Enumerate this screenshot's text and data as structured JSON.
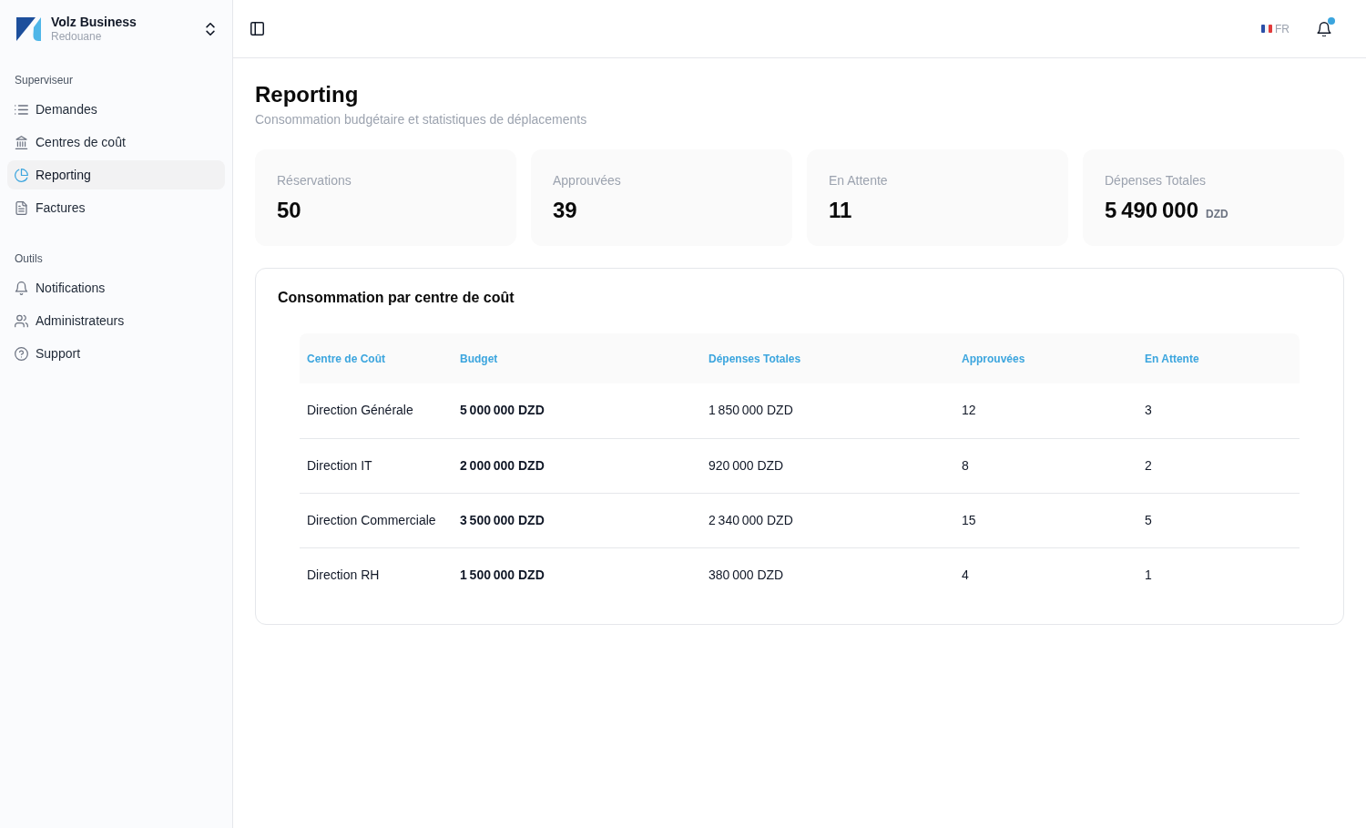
{
  "sidebar": {
    "workspace": {
      "name": "Volz Business",
      "user": "Redouane"
    },
    "sections": [
      {
        "title": "Superviseur",
        "items": [
          {
            "label": "Demandes",
            "selected": false
          },
          {
            "label": "Centres de coût",
            "selected": false
          },
          {
            "label": "Reporting",
            "selected": true
          },
          {
            "label": "Factures",
            "selected": false
          }
        ]
      },
      {
        "title": "Outils",
        "items": [
          {
            "label": "Notifications",
            "selected": false
          },
          {
            "label": "Administrateurs",
            "selected": false
          },
          {
            "label": "Support",
            "selected": false
          }
        ]
      }
    ]
  },
  "header": {
    "language": {
      "code": "FR"
    },
    "notifications": {
      "unread": true
    }
  },
  "page": {
    "title": "Reporting",
    "subtitle": "Consommation budgétaire et statistiques de déplacements"
  },
  "stats": [
    {
      "label": "Réservations",
      "value": "50"
    },
    {
      "label": "Approuvées",
      "value": "39"
    },
    {
      "label": "En Attente",
      "value": "11"
    },
    {
      "label": "Dépenses Totales",
      "value": "5 490 000",
      "unit": "DZD"
    }
  ],
  "table": {
    "title": "Consommation par centre de coût",
    "columns": [
      "Centre de Coût",
      "Budget",
      "Dépenses Totales",
      "Approuvées",
      "En Attente"
    ],
    "rows": [
      [
        "Direction Générale",
        "5 000 000 DZD",
        "1 850 000 DZD",
        "12",
        "3"
      ],
      [
        "Direction IT",
        "2 000 000 DZD",
        "920 000 DZD",
        "8",
        "2"
      ],
      [
        "Direction Commerciale",
        "3 500 000 DZD",
        "2 340 000 DZD",
        "15",
        "5"
      ],
      [
        "Direction RH",
        "1 500 000 DZD",
        "380 000 DZD",
        "4",
        "1"
      ]
    ]
  }
}
